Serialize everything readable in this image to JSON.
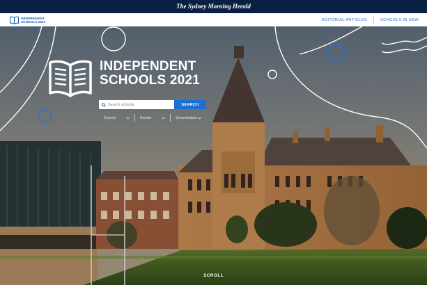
{
  "masthead": {
    "title": "The Sydney Morning Herald"
  },
  "nav": {
    "logo_text": "INDEPENDENT SCHOOLS 2021",
    "links": [
      {
        "label": "EDITORIAL ARTICLES"
      },
      {
        "label": "SCHOOLS IN NSW"
      }
    ]
  },
  "hero": {
    "title_line1": "INDEPENDENT",
    "title_line2": "SCHOOLS 2021",
    "search": {
      "placeholder": "Search schools",
      "button_label": "SEARCH"
    },
    "filters": [
      {
        "label": "Council"
      },
      {
        "label": "Gender"
      },
      {
        "label": "Denomination"
      }
    ],
    "scroll_label": "SCROLL"
  },
  "colors": {
    "masthead_bg": "#0a1f44",
    "accent_blue": "#1d6fd1",
    "nav_link": "#2a6fc9",
    "circle_outline": "#2f6fd6"
  },
  "icons": [
    "book-icon",
    "search-icon",
    "chevron-down-icon"
  ]
}
